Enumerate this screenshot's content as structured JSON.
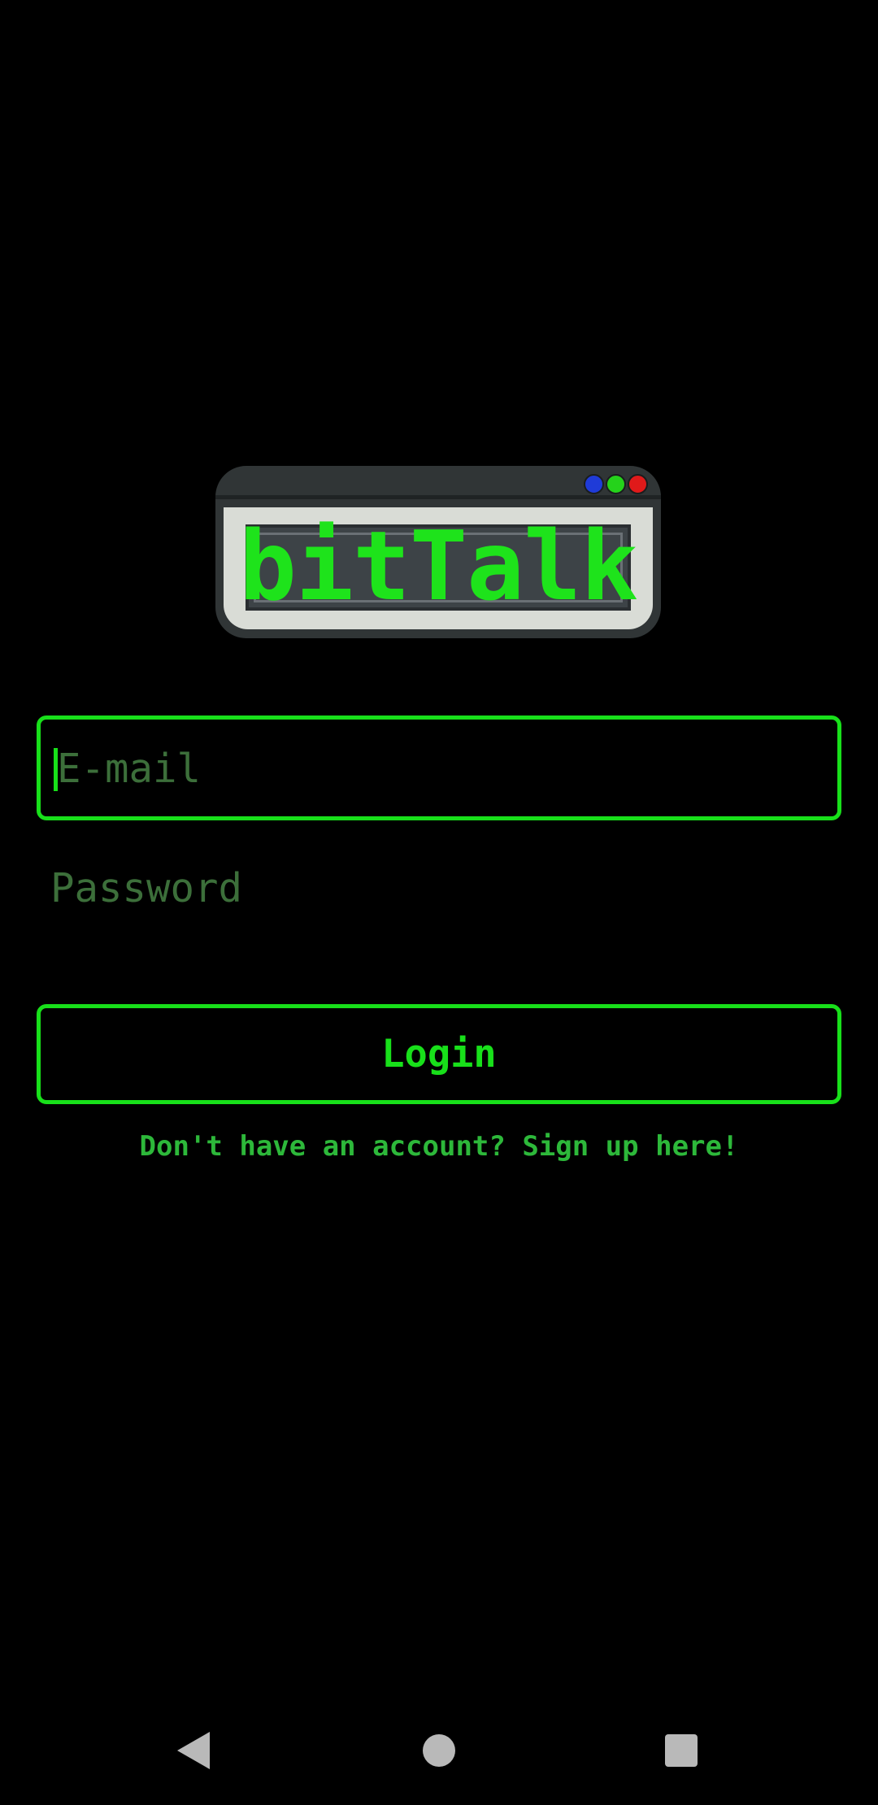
{
  "logo": {
    "text": "bitTalk"
  },
  "form": {
    "email_placeholder": "E-mail",
    "email_value": "",
    "password_placeholder": "Password",
    "password_value": "",
    "login_label": "Login",
    "signup_text": "Don't have an account? Sign up here!"
  },
  "colors": {
    "accent": "#18e01a",
    "placeholder": "#3c6f3a",
    "link": "#2db83a",
    "background": "#000000"
  },
  "nav_bar": {
    "back_icon": "triangle-back-icon",
    "home_icon": "circle-home-icon",
    "recents_icon": "square-recents-icon"
  }
}
